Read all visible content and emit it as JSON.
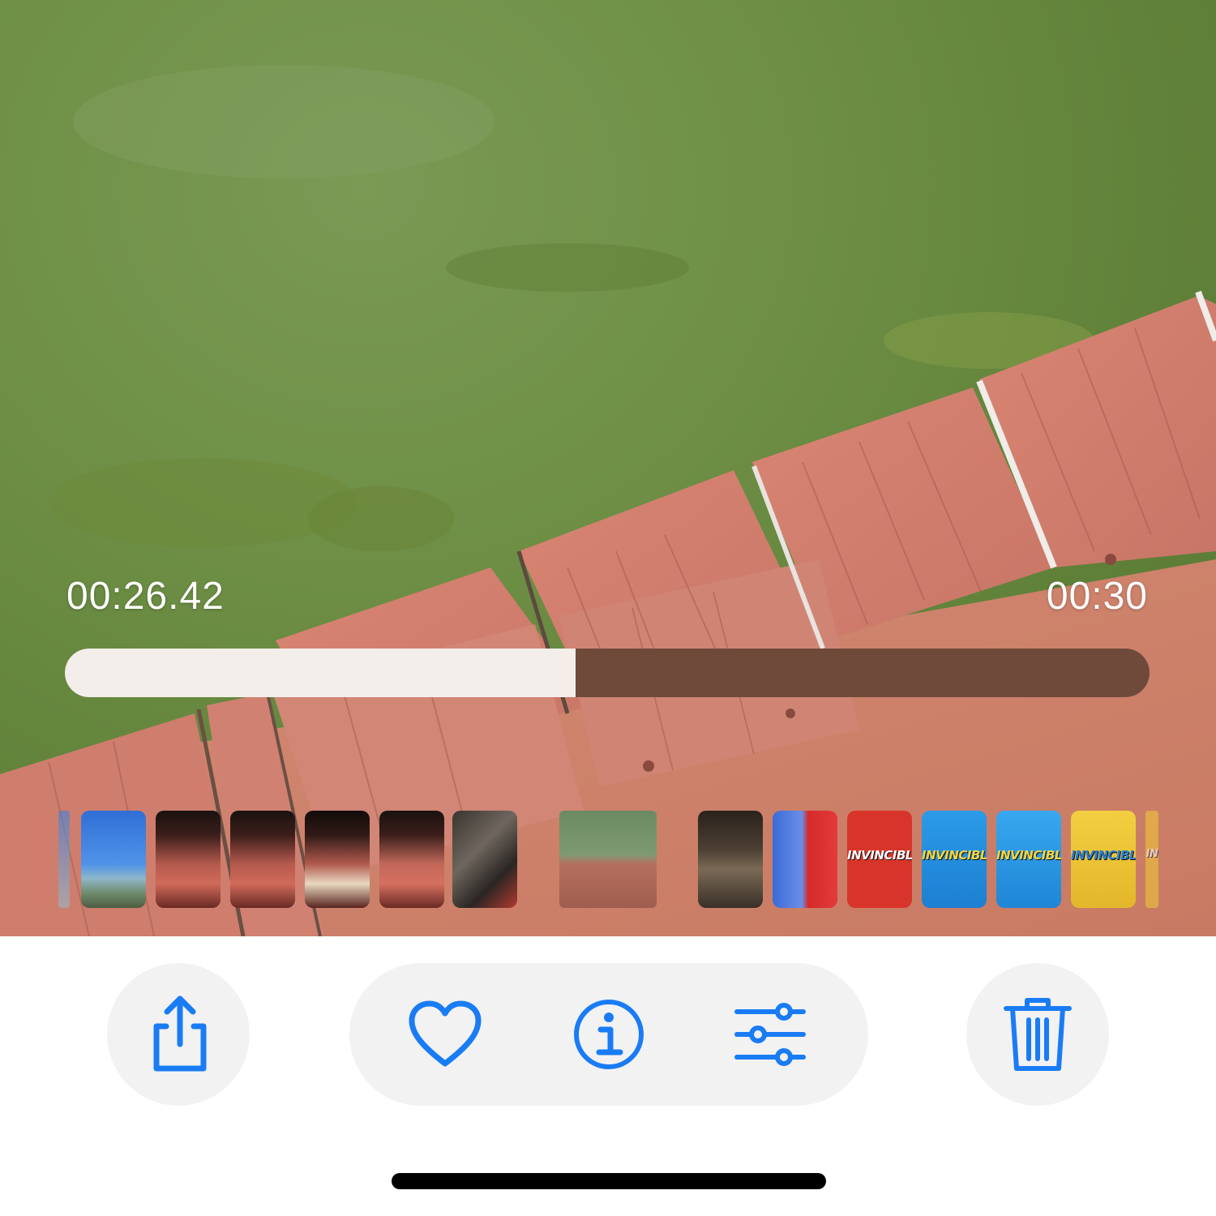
{
  "player": {
    "elapsed_time": "00:26.42",
    "total_time": "00:30",
    "progress_fraction": 0.4708
  },
  "thumbnail_strip": {
    "items": [
      {
        "kind": "partial-beach"
      },
      {
        "kind": "beach-sky"
      },
      {
        "kind": "night-building"
      },
      {
        "kind": "night-building"
      },
      {
        "kind": "night-building"
      },
      {
        "kind": "night-building"
      },
      {
        "kind": "night-car-lights"
      },
      {
        "kind": "current-dock-water"
      },
      {
        "kind": "indoor-dark"
      },
      {
        "kind": "game-characters"
      },
      {
        "kind": "invincible-red",
        "text": "INVINCIBLE"
      },
      {
        "kind": "invincible-blue",
        "text": "INVINCIBLE"
      },
      {
        "kind": "invincible-blue",
        "text": "INVINCIBLE"
      },
      {
        "kind": "invincible-yellow",
        "text": "INVINCIBLE"
      },
      {
        "kind": "partial-yellow",
        "text": "IN"
      }
    ]
  },
  "toolbar": {
    "share_icon": "share-icon",
    "favorite_icon": "heart-icon",
    "info_icon": "info-icon",
    "adjust_icon": "sliders-icon",
    "delete_icon": "trash-icon"
  },
  "colors": {
    "accent": "#1a7cf5",
    "button_bg": "#f2f2f3",
    "scrubber_played": "#f4eeea",
    "scrubber_remaining": "#6f4a3b"
  }
}
